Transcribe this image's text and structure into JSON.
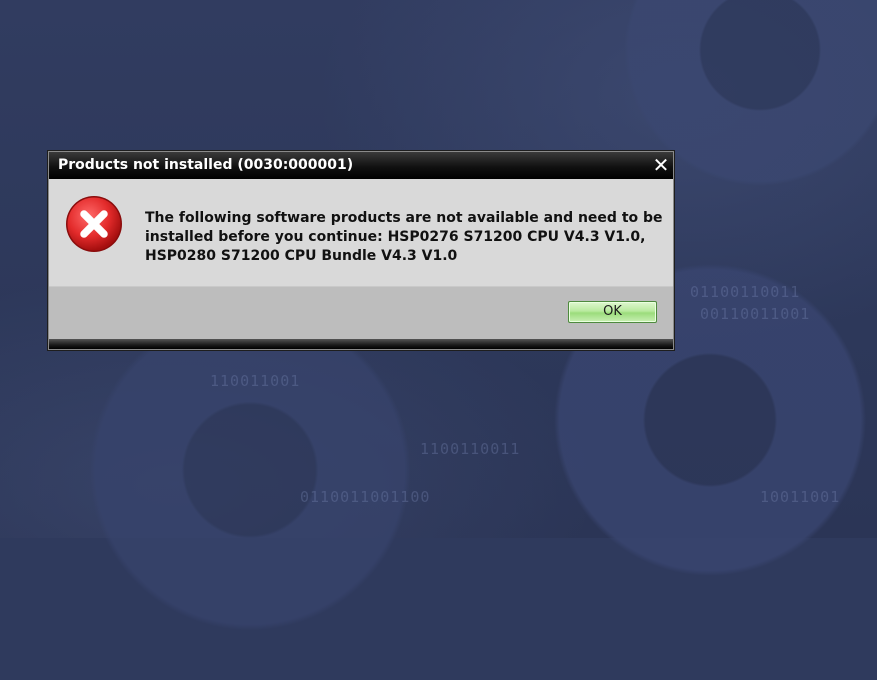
{
  "desktop": {
    "background_binary": [
      "01100110011",
      "00110011001",
      "1100110011",
      "0110011001100",
      "10011001",
      "110011001"
    ]
  },
  "dialog": {
    "title": "Products not installed (0030:000001)",
    "close_glyph": "✕",
    "icon": "error-icon",
    "message": "The following software products are not available and need to be installed before you continue: HSP0276 S71200 CPU V4.3 V1.0, HSP0280 S71200 CPU Bundle V4.3 V1.0",
    "ok_label": "OK"
  },
  "colors": {
    "error_red": "#e32b2b",
    "ok_green": "#b9ea9f",
    "title_bar": "#000000",
    "background": "#2f3a5d"
  }
}
